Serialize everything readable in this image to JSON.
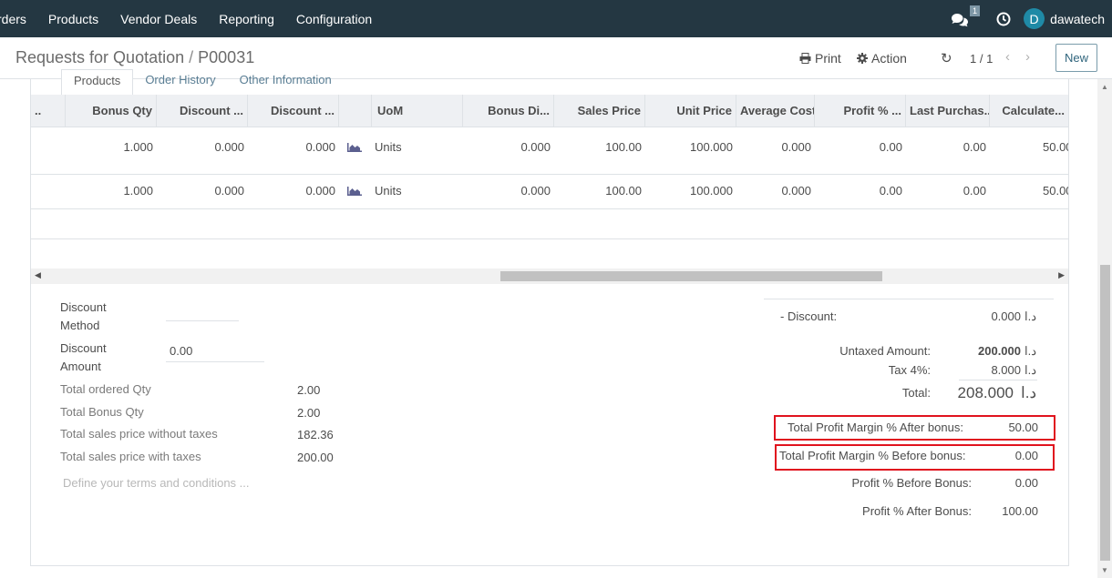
{
  "nav": {
    "items": [
      "rders",
      "Products",
      "Vendor Deals",
      "Reporting",
      "Configuration"
    ],
    "chat_badge": "1",
    "user_initial": "D",
    "user_name": "dawatech"
  },
  "control": {
    "breadcrumb_parent": "Requests for Quotation",
    "breadcrumb_sep": "/",
    "breadcrumb_current": "P00031",
    "print": "Print",
    "action": "Action",
    "pager": "1 / 1",
    "new": "New"
  },
  "tabs": [
    "Products",
    "Order History",
    "Other Information"
  ],
  "table": {
    "headers": [
      "..",
      "Bonus Qty",
      "Discount ...",
      "Discount ...",
      "",
      "UoM",
      "Bonus Di...",
      "Sales Price",
      "Unit Price",
      "Average Cost",
      "Profit % ...",
      "Last Purchas...",
      "Calculate..."
    ],
    "rows": [
      [
        "1.000",
        "0.000",
        "0.000",
        "Units",
        "0.000",
        "100.00",
        "100.000",
        "0.000",
        "0.00",
        "0.00",
        "50.00"
      ],
      [
        "1.000",
        "0.000",
        "0.000",
        "Units",
        "0.000",
        "100.00",
        "100.000",
        "0.000",
        "0.00",
        "0.00",
        "50.00"
      ]
    ]
  },
  "left": {
    "discount_method_label": "Discount Method",
    "discount_method_value": "",
    "discount_amount_label": "Discount Amount",
    "discount_amount_value": "0.00",
    "total_ordered_qty_label": "Total ordered Qty",
    "total_ordered_qty": "2.00",
    "total_bonus_qty_label": "Total Bonus Qty",
    "total_bonus_qty": "2.00",
    "sales_wo_tax_label": "Total sales price without taxes",
    "sales_wo_tax": "182.36",
    "sales_with_tax_label": "Total sales price with taxes",
    "sales_with_tax": "200.00",
    "terms_placeholder": "Define your terms and conditions ..."
  },
  "totals": {
    "discount_label": "- Discount:",
    "discount_value": "0.000",
    "currency": "د.ا",
    "untaxed_label": "Untaxed Amount:",
    "untaxed_value": "200.000",
    "tax_label": "Tax 4%:",
    "tax_value": "8.000",
    "total_label": "Total:",
    "total_value": "208.000",
    "margin_after_label": "Total Profit Margin % After bonus:",
    "margin_after_value": "50.00",
    "margin_before_label": "Total Profit Margin % Before bonus:",
    "margin_before_value": "0.00",
    "profit_before_label": "Profit % Before Bonus:",
    "profit_before_value": "0.00",
    "profit_after_label": "Profit % After Bonus:",
    "profit_after_value": "100.00"
  },
  "colors": {
    "navbar": "#243742",
    "highlight": "#e0131e",
    "link": "#5a7e94"
  }
}
